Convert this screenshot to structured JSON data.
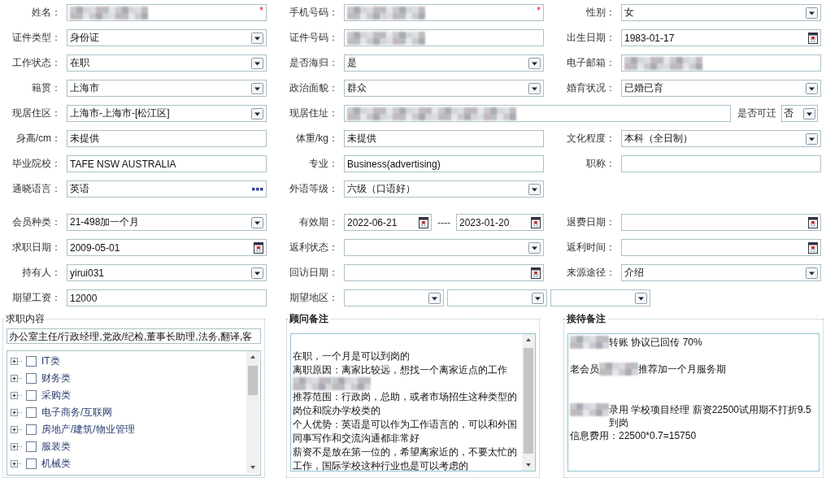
{
  "profile": {
    "rows": [
      [
        {
          "label": "姓名：",
          "kind": "text",
          "redacted": true,
          "required_mark": "*"
        },
        {
          "label": "手机号码：",
          "kind": "text",
          "redacted": true,
          "required_mark": "*"
        },
        {
          "label": "性别：",
          "kind": "select",
          "value": "女"
        }
      ],
      [
        {
          "label": "证件类型：",
          "kind": "select",
          "value": "身份证"
        },
        {
          "label": "证件号码：",
          "kind": "text",
          "redacted": true
        },
        {
          "label": "出生日期：",
          "kind": "date",
          "value": "1983-01-17"
        }
      ],
      [
        {
          "label": "工作状态：",
          "kind": "select",
          "value": "在职"
        },
        {
          "label": "是否海归：",
          "kind": "select",
          "value": "是"
        },
        {
          "label": "电子邮箱：",
          "kind": "text",
          "redacted": true
        }
      ],
      [
        {
          "label": "籍贯：",
          "kind": "select",
          "value": "上海市"
        },
        {
          "label": "政治面貌：",
          "kind": "select",
          "value": "群众"
        },
        {
          "label": "婚育状况：",
          "kind": "select",
          "value": "已婚已育"
        }
      ],
      [
        {
          "label": "现居住区：",
          "kind": "select",
          "value": " 上海市-上海市-[松江区]"
        },
        {
          "label": "现居住址：",
          "kind": "text",
          "redacted": true,
          "extra": {
            "label": "是否可迁",
            "kind": "select",
            "value": "否"
          }
        }
      ],
      [
        {
          "label": "身高/cm：",
          "kind": "text",
          "value": "未提供"
        },
        {
          "label": "体重/kg：",
          "kind": "text",
          "value": "未提供"
        },
        {
          "label": "文化程度：",
          "kind": "select",
          "value": "本科（全日制）"
        }
      ],
      [
        {
          "label": "毕业院校：",
          "kind": "text",
          "value": "TAFE NSW AUSTRALIA"
        },
        {
          "label": "专业：",
          "kind": "text",
          "value": "Business(advertising)"
        },
        {
          "label": "职称：",
          "kind": "text"
        }
      ],
      [
        {
          "label": "通晓语言：",
          "kind": "lookup",
          "value": "英语"
        },
        {
          "label": "外语等级：",
          "kind": "select",
          "value": "六级（口语好）"
        }
      ]
    ]
  },
  "membership": {
    "rows": [
      [
        {
          "label": "会员种类：",
          "kind": "select",
          "value": " 21-498加一个月"
        },
        {
          "label": "有效期：",
          "kind": "date-range",
          "from": "2022-06-21",
          "separator": "----",
          "to": "2023-01-20"
        },
        {
          "label": "退费日期：",
          "kind": "date"
        }
      ],
      [
        {
          "label": "求职日期：",
          "kind": "date",
          "value": "2009-05-01"
        },
        {
          "label": "返利状态：",
          "kind": "select"
        },
        {
          "label": "返利时间：",
          "kind": "date"
        }
      ],
      [
        {
          "label": "持有人：",
          "kind": "select",
          "value": "yirui031"
        },
        {
          "label": "回访日期：",
          "kind": "date"
        },
        {
          "label": "来源途径：",
          "kind": "select",
          "value": "介绍"
        }
      ],
      [
        {
          "label": "期望工资：",
          "kind": "text",
          "value": "12000"
        },
        {
          "label": "期望地区：",
          "kind": "multi-select",
          "selects": [
            {
              "kind": "select"
            },
            {
              "kind": "select"
            },
            {
              "kind": "select"
            }
          ]
        }
      ]
    ]
  },
  "job_intent": {
    "title": "求职内容",
    "value": "办公室主任/行政经理,党政/纪检,董事长助理,法务,翻译,客",
    "tree": [
      {
        "label": "IT类",
        "expanded": false,
        "checked": false
      },
      {
        "label": "财务类",
        "expanded": false,
        "checked": false
      },
      {
        "label": "采购类",
        "expanded": false,
        "checked": false
      },
      {
        "label": "电子商务/互联网",
        "expanded": false,
        "checked": false
      },
      {
        "label": "房地产/建筑/物业管理",
        "expanded": false,
        "checked": false
      },
      {
        "label": "服装类",
        "expanded": false,
        "checked": false
      },
      {
        "label": "机械类",
        "expanded": false,
        "checked": false
      }
    ]
  },
  "consultant_notes": {
    "title": "顾问备注",
    "lines": [
      [
        {
          "kind": "blank"
        }
      ],
      [
        {
          "kind": "text",
          "text": "在职，一个月是可以到岗的"
        }
      ],
      [
        {
          "kind": "text",
          "text": "离职原因：离家比较远，想找一个离家近点的工作"
        }
      ],
      [
        {
          "kind": "redacted"
        },
        {
          "kind": "redacted"
        }
      ],
      [
        {
          "kind": "text",
          "text": "推荐范围：行政岗，总助，或者市场招生这种类型的岗位和院办学校类的"
        }
      ],
      [
        {
          "kind": "text",
          "text": "个人优势：英语是可以作为工作语言的，可以和外国同事写作和交流沟通都非常好"
        }
      ],
      [
        {
          "kind": "text",
          "text": "薪资不是放在第一位的，希望离家近的，不要太忙的工作，国际学校这种行业也是可以考虑的"
        }
      ]
    ]
  },
  "reception_notes": {
    "title": "接待备注",
    "lines": [
      [
        {
          "kind": "redacted"
        },
        {
          "kind": "text",
          "text": " 转账 协议已回传 70%"
        }
      ],
      [
        {
          "kind": "blank"
        }
      ],
      [
        {
          "kind": "text",
          "text": "老会员"
        },
        {
          "kind": "redacted"
        },
        {
          "kind": "text",
          "text": "推荐加一个月服务期"
        }
      ],
      [
        {
          "kind": "blank"
        }
      ],
      [
        {
          "kind": "blank"
        }
      ],
      [
        {
          "kind": "redacted"
        },
        {
          "kind": "text",
          "text": "录用 学校项目经理  薪资22500试用期不打折9.5到岗"
        }
      ],
      [
        {
          "kind": "text",
          "text": "信息费用：22500*0.7=15750"
        }
      ]
    ]
  }
}
